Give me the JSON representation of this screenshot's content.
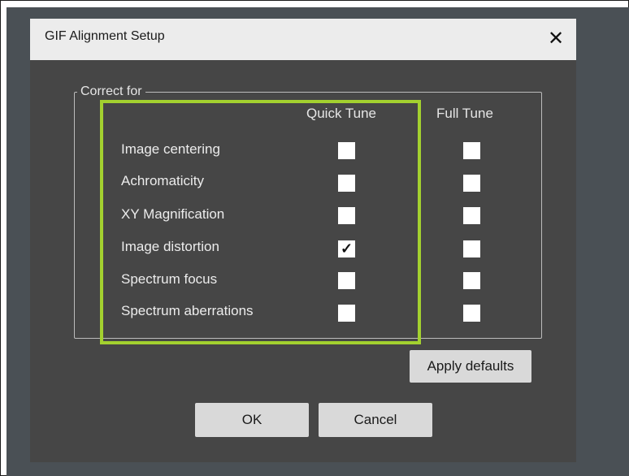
{
  "dialog": {
    "title": "GIF Alignment Setup",
    "close_glyph": "✕"
  },
  "group": {
    "legend": "Correct for"
  },
  "columns": {
    "quick": "Quick Tune",
    "full": "Full Tune"
  },
  "rows": [
    {
      "label": "Image centering",
      "quick_checked": false,
      "full_checked": false
    },
    {
      "label": "Achromaticity",
      "quick_checked": false,
      "full_checked": false
    },
    {
      "label": "XY Magnification",
      "quick_checked": false,
      "full_checked": false
    },
    {
      "label": "Image distortion",
      "quick_checked": true,
      "full_checked": false
    },
    {
      "label": "Spectrum focus",
      "quick_checked": false,
      "full_checked": false
    },
    {
      "label": "Spectrum aberrations",
      "quick_checked": false,
      "full_checked": false
    }
  ],
  "check_glyph": "✓",
  "buttons": {
    "apply_defaults": "Apply defaults",
    "ok": "OK",
    "cancel": "Cancel"
  },
  "colors": {
    "highlight": "#a3d12f",
    "dialog_bg": "#464646",
    "titlebar_bg": "#ececec"
  }
}
